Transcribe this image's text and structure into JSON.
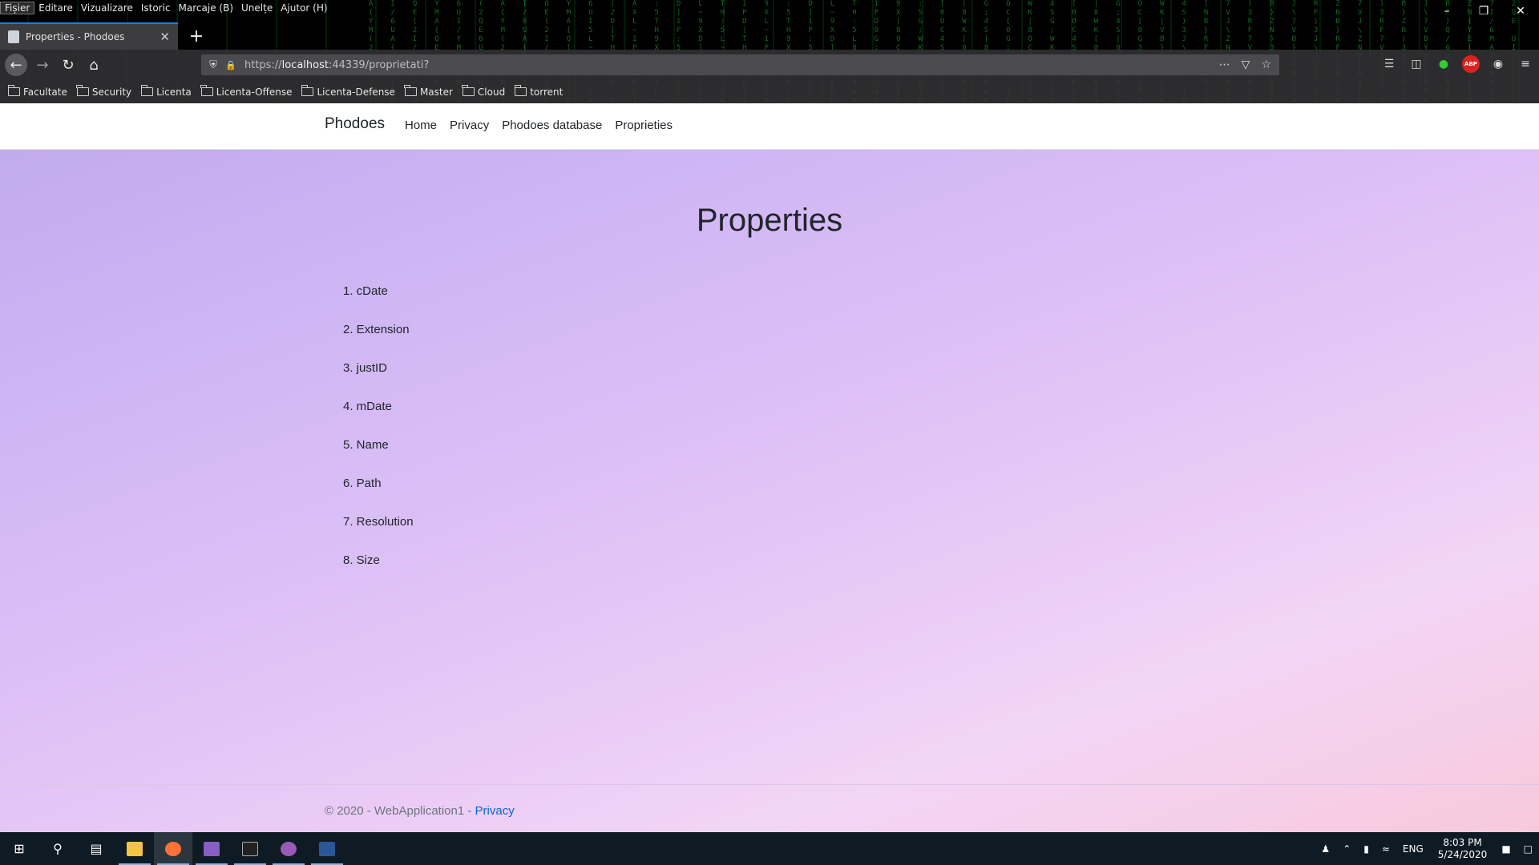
{
  "browser": {
    "menu": [
      "Fișier",
      "Editare",
      "Vizualizare",
      "Istoric",
      "Marcaje (B)",
      "Unelțe",
      "Ajutor (H)"
    ],
    "tab_title": "Properties - Phodoes",
    "url_scheme": "https://",
    "url_host": "localhost",
    "url_rest": ":44339/proprietati?",
    "bookmarks": [
      "Facultate",
      "Security",
      "Licenta",
      "Licenta-Offense",
      "Licenta-Defense",
      "Master",
      "Cloud",
      "torrent"
    ]
  },
  "site": {
    "brand": "Phodoes",
    "nav": [
      "Home",
      "Privacy",
      "Phodoes database",
      "Proprieties"
    ],
    "heading": "Properties",
    "properties": [
      "1. cDate",
      "2. Extension",
      "3. justID",
      "4. mDate",
      "5. Name",
      "6. Path",
      "7. Resolution",
      "8. Size"
    ],
    "footer_text": "© 2020 - WebApplication1 - ",
    "footer_link": "Privacy"
  },
  "taskbar": {
    "lang": "ENG",
    "time": "8:03 PM",
    "date": "5/24/2020"
  },
  "colors": {
    "accent_tab": "#0a84ff",
    "link": "#0366d6",
    "matrix_green": "#1fbf3a"
  }
}
